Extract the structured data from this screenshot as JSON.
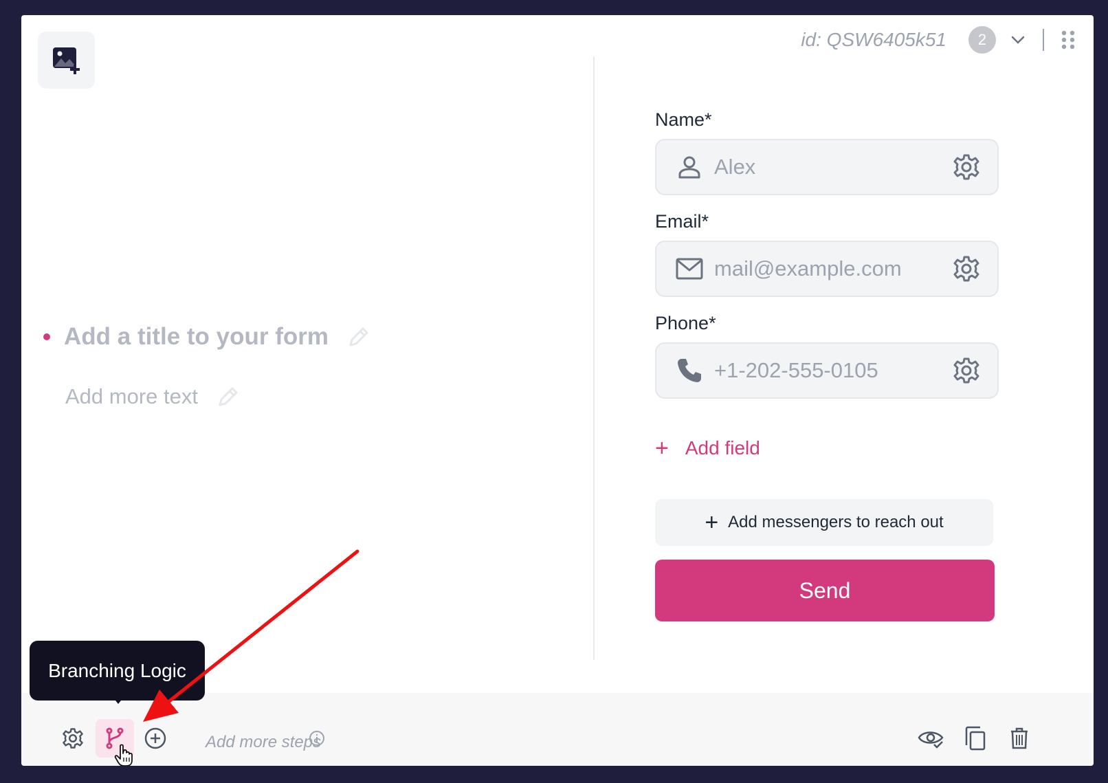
{
  "header": {
    "form_id": "id: QSW6405k51",
    "badge_count": "2"
  },
  "left": {
    "title_placeholder": "Add a title to your form",
    "text_placeholder": "Add more text"
  },
  "fields": [
    {
      "label": "Name*",
      "placeholder": "Alex",
      "icon": "user-icon"
    },
    {
      "label": "Email*",
      "placeholder": "mail@example.com",
      "icon": "mail-icon"
    },
    {
      "label": "Phone*",
      "placeholder": "+1-202-555-0105",
      "icon": "phone-icon"
    }
  ],
  "actions": {
    "add_field": "Add field",
    "add_messengers": "Add messengers to reach out",
    "send": "Send"
  },
  "bottom_bar": {
    "tooltip": "Branching Logic",
    "add_steps": "Add more steps"
  },
  "colors": {
    "accent": "#d33a7d",
    "background": "#1f1f3d",
    "arrow": "#ee1111"
  }
}
